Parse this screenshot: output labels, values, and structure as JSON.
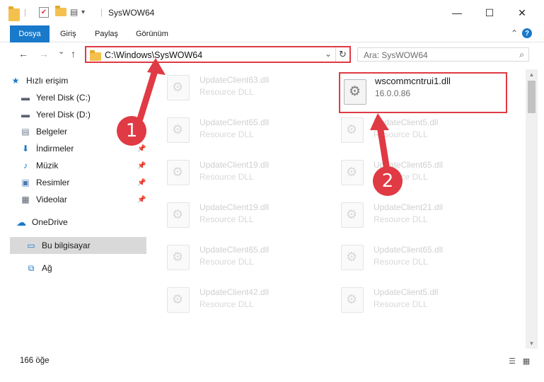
{
  "window": {
    "title": "SysWOW64",
    "minimize_glyph": "—",
    "maximize_glyph": "☐",
    "close_glyph": "✕"
  },
  "quick_access_toolbar": {
    "separator_glyph": "|",
    "dropdown_glyph": "▾"
  },
  "ribbon": {
    "tabs": [
      "Dosya",
      "Giriş",
      "Paylaş",
      "Görünüm"
    ],
    "collapse_glyph": "⌃",
    "help_glyph": "?"
  },
  "navigation": {
    "back_glyph": "←",
    "forward_glyph": "→",
    "recent_glyph": "⌄",
    "up_glyph": "↑",
    "address": "C:\\Windows\\SysWOW64",
    "address_dropdown_glyph": "⌄",
    "refresh_glyph": "↻",
    "search_placeholder": "Ara: SysWOW64",
    "search_glyph": "⌕"
  },
  "sidebar": {
    "items": [
      {
        "label": "Hızlı erişim",
        "icon": "star-icon",
        "glyph": "★",
        "color": "#1979ca",
        "pinned": false
      },
      {
        "label": "Yerel Disk (C:)",
        "icon": "drive-icon",
        "glyph": "▬",
        "color": "#5a6270",
        "pinned": false
      },
      {
        "label": "Yerel Disk (D:)",
        "icon": "drive-icon",
        "glyph": "▬",
        "color": "#5a6270",
        "pinned": false
      },
      {
        "label": "Belgeler",
        "icon": "document-icon",
        "glyph": "▤",
        "color": "#6a7b8c",
        "pinned": false
      },
      {
        "label": "İndirmeler",
        "icon": "download-icon",
        "glyph": "⬇",
        "color": "#1979ca",
        "pinned": true
      },
      {
        "label": "Müzik",
        "icon": "music-icon",
        "glyph": "♪",
        "color": "#1979ca",
        "pinned": true
      },
      {
        "label": "Resimler",
        "icon": "pictures-icon",
        "glyph": "▣",
        "color": "#4a7bb0",
        "pinned": true
      },
      {
        "label": "Videolar",
        "icon": "video-icon",
        "glyph": "▦",
        "color": "#5a6270",
        "pinned": true
      },
      {
        "label": "OneDrive",
        "icon": "cloud-icon",
        "glyph": "☁",
        "color": "#1979ca",
        "pinned": false
      },
      {
        "label": "Bu bilgisayar",
        "icon": "computer-icon",
        "glyph": "▭",
        "color": "#1979ca",
        "pinned": false,
        "selected": true
      },
      {
        "label": "Ağ",
        "icon": "network-icon",
        "glyph": "⧉",
        "color": "#1979ca",
        "pinned": false
      }
    ],
    "pin_glyph": "📌"
  },
  "files": {
    "left_column": [
      {
        "name": "UpdateClient63.dll",
        "type": "Resource DLL"
      },
      {
        "name": "UpdateClient65.dll",
        "type": "Resource DLL"
      },
      {
        "name": "UpdateClient19.dll",
        "type": "Resource DLL"
      },
      {
        "name": "UpdateClient19.dll",
        "type": "Resource DLL"
      },
      {
        "name": "UpdateClient65.dll",
        "type": "Resource DLL"
      },
      {
        "name": "UpdateClient42.dll",
        "type": "Resource DLL"
      }
    ],
    "right_column": [
      {
        "name": "UpdateClient5.dll",
        "type": "Resource DLL"
      },
      {
        "name": "UpdateClient65.dll",
        "type": "Resource DLL"
      },
      {
        "name": "UpdateClient21.dll",
        "type": "Resource DLL"
      },
      {
        "name": "UpdateClient65.dll",
        "type": "Resource DLL"
      },
      {
        "name": "UpdateClient5.dll",
        "type": "Resource DLL"
      }
    ],
    "highlighted": {
      "name": "wscommcntrui1.dll",
      "version": "16.0.0.86"
    }
  },
  "callouts": [
    {
      "number": "1",
      "color": "#e03a44"
    },
    {
      "number": "2",
      "color": "#e03a44"
    }
  ],
  "scrollbar": {
    "up_glyph": "▲",
    "down_glyph": "▼"
  },
  "status": {
    "item_count": "166 öğe",
    "details_view_glyph": "☰",
    "large_icons_view_glyph": "▦"
  }
}
